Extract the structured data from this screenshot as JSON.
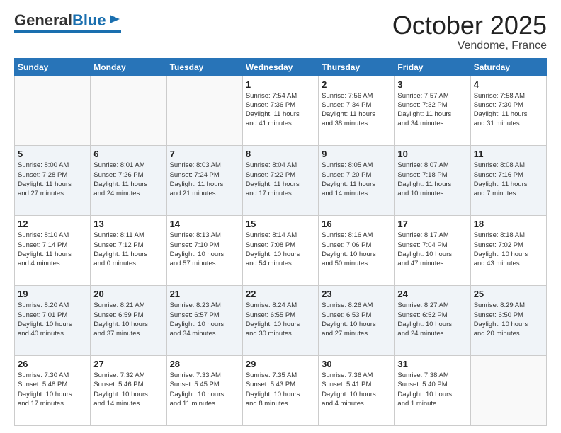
{
  "logo": {
    "general": "General",
    "blue": "Blue"
  },
  "title": "October 2025",
  "location": "Vendome, France",
  "days_header": [
    "Sunday",
    "Monday",
    "Tuesday",
    "Wednesday",
    "Thursday",
    "Friday",
    "Saturday"
  ],
  "weeks": [
    [
      {
        "day": "",
        "info": ""
      },
      {
        "day": "",
        "info": ""
      },
      {
        "day": "",
        "info": ""
      },
      {
        "day": "1",
        "info": "Sunrise: 7:54 AM\nSunset: 7:36 PM\nDaylight: 11 hours\nand 41 minutes."
      },
      {
        "day": "2",
        "info": "Sunrise: 7:56 AM\nSunset: 7:34 PM\nDaylight: 11 hours\nand 38 minutes."
      },
      {
        "day": "3",
        "info": "Sunrise: 7:57 AM\nSunset: 7:32 PM\nDaylight: 11 hours\nand 34 minutes."
      },
      {
        "day": "4",
        "info": "Sunrise: 7:58 AM\nSunset: 7:30 PM\nDaylight: 11 hours\nand 31 minutes."
      }
    ],
    [
      {
        "day": "5",
        "info": "Sunrise: 8:00 AM\nSunset: 7:28 PM\nDaylight: 11 hours\nand 27 minutes."
      },
      {
        "day": "6",
        "info": "Sunrise: 8:01 AM\nSunset: 7:26 PM\nDaylight: 11 hours\nand 24 minutes."
      },
      {
        "day": "7",
        "info": "Sunrise: 8:03 AM\nSunset: 7:24 PM\nDaylight: 11 hours\nand 21 minutes."
      },
      {
        "day": "8",
        "info": "Sunrise: 8:04 AM\nSunset: 7:22 PM\nDaylight: 11 hours\nand 17 minutes."
      },
      {
        "day": "9",
        "info": "Sunrise: 8:05 AM\nSunset: 7:20 PM\nDaylight: 11 hours\nand 14 minutes."
      },
      {
        "day": "10",
        "info": "Sunrise: 8:07 AM\nSunset: 7:18 PM\nDaylight: 11 hours\nand 10 minutes."
      },
      {
        "day": "11",
        "info": "Sunrise: 8:08 AM\nSunset: 7:16 PM\nDaylight: 11 hours\nand 7 minutes."
      }
    ],
    [
      {
        "day": "12",
        "info": "Sunrise: 8:10 AM\nSunset: 7:14 PM\nDaylight: 11 hours\nand 4 minutes."
      },
      {
        "day": "13",
        "info": "Sunrise: 8:11 AM\nSunset: 7:12 PM\nDaylight: 11 hours\nand 0 minutes."
      },
      {
        "day": "14",
        "info": "Sunrise: 8:13 AM\nSunset: 7:10 PM\nDaylight: 10 hours\nand 57 minutes."
      },
      {
        "day": "15",
        "info": "Sunrise: 8:14 AM\nSunset: 7:08 PM\nDaylight: 10 hours\nand 54 minutes."
      },
      {
        "day": "16",
        "info": "Sunrise: 8:16 AM\nSunset: 7:06 PM\nDaylight: 10 hours\nand 50 minutes."
      },
      {
        "day": "17",
        "info": "Sunrise: 8:17 AM\nSunset: 7:04 PM\nDaylight: 10 hours\nand 47 minutes."
      },
      {
        "day": "18",
        "info": "Sunrise: 8:18 AM\nSunset: 7:02 PM\nDaylight: 10 hours\nand 43 minutes."
      }
    ],
    [
      {
        "day": "19",
        "info": "Sunrise: 8:20 AM\nSunset: 7:01 PM\nDaylight: 10 hours\nand 40 minutes."
      },
      {
        "day": "20",
        "info": "Sunrise: 8:21 AM\nSunset: 6:59 PM\nDaylight: 10 hours\nand 37 minutes."
      },
      {
        "day": "21",
        "info": "Sunrise: 8:23 AM\nSunset: 6:57 PM\nDaylight: 10 hours\nand 34 minutes."
      },
      {
        "day": "22",
        "info": "Sunrise: 8:24 AM\nSunset: 6:55 PM\nDaylight: 10 hours\nand 30 minutes."
      },
      {
        "day": "23",
        "info": "Sunrise: 8:26 AM\nSunset: 6:53 PM\nDaylight: 10 hours\nand 27 minutes."
      },
      {
        "day": "24",
        "info": "Sunrise: 8:27 AM\nSunset: 6:52 PM\nDaylight: 10 hours\nand 24 minutes."
      },
      {
        "day": "25",
        "info": "Sunrise: 8:29 AM\nSunset: 6:50 PM\nDaylight: 10 hours\nand 20 minutes."
      }
    ],
    [
      {
        "day": "26",
        "info": "Sunrise: 7:30 AM\nSunset: 5:48 PM\nDaylight: 10 hours\nand 17 minutes."
      },
      {
        "day": "27",
        "info": "Sunrise: 7:32 AM\nSunset: 5:46 PM\nDaylight: 10 hours\nand 14 minutes."
      },
      {
        "day": "28",
        "info": "Sunrise: 7:33 AM\nSunset: 5:45 PM\nDaylight: 10 hours\nand 11 minutes."
      },
      {
        "day": "29",
        "info": "Sunrise: 7:35 AM\nSunset: 5:43 PM\nDaylight: 10 hours\nand 8 minutes."
      },
      {
        "day": "30",
        "info": "Sunrise: 7:36 AM\nSunset: 5:41 PM\nDaylight: 10 hours\nand 4 minutes."
      },
      {
        "day": "31",
        "info": "Sunrise: 7:38 AM\nSunset: 5:40 PM\nDaylight: 10 hours\nand 1 minute."
      },
      {
        "day": "",
        "info": ""
      }
    ]
  ]
}
